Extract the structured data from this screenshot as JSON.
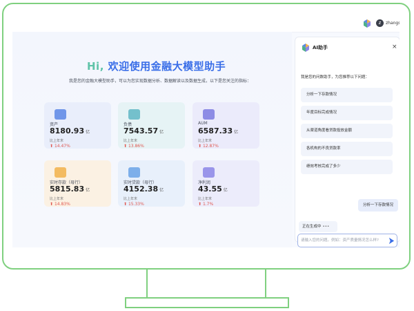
{
  "topbar": {
    "username": "zhangsan",
    "avatar_letter": "z"
  },
  "main": {
    "title_hi": "Hi,",
    "title_rest": " 欢迎使用金融大模型助手",
    "subtitle": "我是您的金融大模型助手，可以为您实现数据分析、数据解读以及数据生成，以下是您关注的指标：",
    "cards": [
      {
        "name": "资产",
        "value": "8180.93",
        "unit": "亿",
        "compare_label": "比上年末",
        "change": "14.47%",
        "icon": "wallet-icon",
        "bg": "#e9eefb",
        "icon_color": "#5b86e5"
      },
      {
        "name": "负债",
        "value": "7543.57",
        "unit": "亿",
        "compare_label": "比上年末",
        "change": "13.86%",
        "icon": "ledger-icon",
        "bg": "#e6f3f5",
        "icon_color": "#5fb6c4"
      },
      {
        "name": "AUM",
        "value": "6587.33",
        "unit": "亿",
        "compare_label": "比上年末",
        "change": "12.87%",
        "icon": "shield-icon",
        "bg": "#ebebfb",
        "icon_color": "#7d7be0"
      },
      {
        "name": "实时存款（母行）",
        "value": "5815.83",
        "unit": "亿",
        "compare_label": "比上年末",
        "change": "14.83%",
        "icon": "coin-icon",
        "bg": "#fbf1e3",
        "icon_color": "#f1b14a"
      },
      {
        "name": "实时贷款（母行）",
        "value": "4152.38",
        "unit": "亿",
        "compare_label": "比上年末",
        "change": "15.33%",
        "icon": "bar-chart-icon",
        "bg": "#e8f0fb",
        "icon_color": "#6aa3e6"
      },
      {
        "name": "净利润",
        "value": "43.55",
        "unit": "亿",
        "compare_label": "比上年末",
        "change": "1.7%",
        "icon": "lock-icon",
        "bg": "#ececfb",
        "icon_color": "#8c86e6"
      }
    ]
  },
  "chat": {
    "title": "AI助手",
    "close": "×",
    "intro": "我是您的问数助手，为您推荐以下问题：",
    "suggestions": [
      "分析一下存款情况",
      "年度目标完成情况",
      "从渠道角度看贷款投放金额",
      "各机构的不良贷款率",
      "绩效考核完成了多少"
    ],
    "user_message": "分析一下存款情况",
    "generating": "正在生成中",
    "generating_dots": "•••",
    "input_placeholder": "请输入您的问题。例如：资产质量情况怎么样?"
  },
  "colors": {
    "accent": "#3a6ee8",
    "up_red": "#e0574f",
    "monitor_frame": "#7fd07f"
  }
}
